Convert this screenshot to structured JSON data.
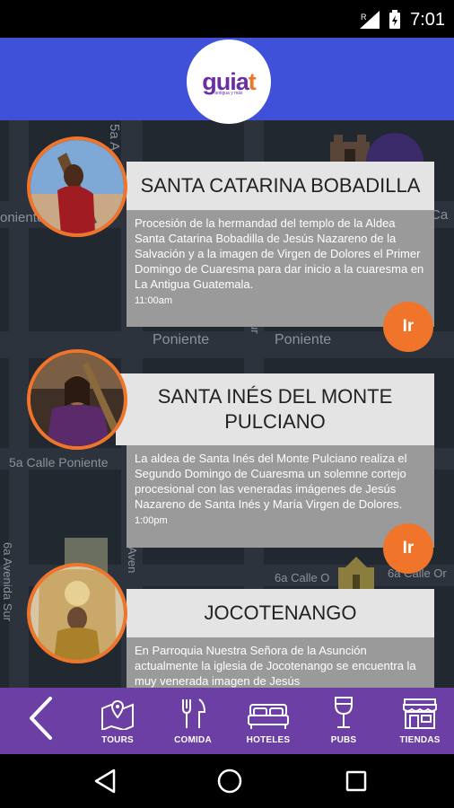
{
  "status_bar": {
    "time": "7:01"
  },
  "header": {
    "logo_text": "guia",
    "logo_accent": "t",
    "logo_tagline": "antigua y más"
  },
  "map_labels": [
    "5a A",
    "oniente",
    "Ca",
    "Poniente",
    "Poniente",
    "5a Calle Poniente",
    "6a Avenida Sur",
    "6a Calle O",
    "6a Calle Or",
    "Aven",
    "ur"
  ],
  "events": [
    {
      "title": "SANTA CATARINA BOBADILLA",
      "description": "Procesión de la hermandad del templo de la Aldea Santa Catarina Bobadilla de Jesús Nazareno de la Salvación y a la imagen de Virgen de Dolores el Primer Domingo de Cuaresma para dar inicio a la cuaresma en La Antigua Guatemala.",
      "time": "11:00am",
      "button": "Ir"
    },
    {
      "title": "SANTA INÉS DEL MONTE PULCIANO",
      "description": "La aldea de Santa Inés del Monte Pulciano realiza el Segundo Domingo de Cuaresma un solemne cortejo procesional con las veneradas imágenes de Jesús Nazareno de Santa Inés y María Virgen de Dolores.",
      "time": "1:00pm",
      "button": "Ir"
    },
    {
      "title": "JOCOTENANGO",
      "description": "En Parroquia Nuestra Señora de la Asunción actualmente la iglesia de Jocotenango se encuentra la muy venerada imagen de Jesús",
      "time": "",
      "button": ""
    }
  ],
  "toolbar": {
    "items": [
      {
        "label": "TOURS",
        "icon": "map-icon"
      },
      {
        "label": "COMIDA",
        "icon": "fork-knife-icon"
      },
      {
        "label": "HOTELES",
        "icon": "bed-icon"
      },
      {
        "label": "PUBS",
        "icon": "wine-glass-icon"
      },
      {
        "label": "TIENDAS",
        "icon": "store-icon"
      }
    ]
  },
  "colors": {
    "primary": "#3f51d8",
    "accent": "#f0752b",
    "toolbar": "#6b3fa3",
    "map": "#222830"
  }
}
